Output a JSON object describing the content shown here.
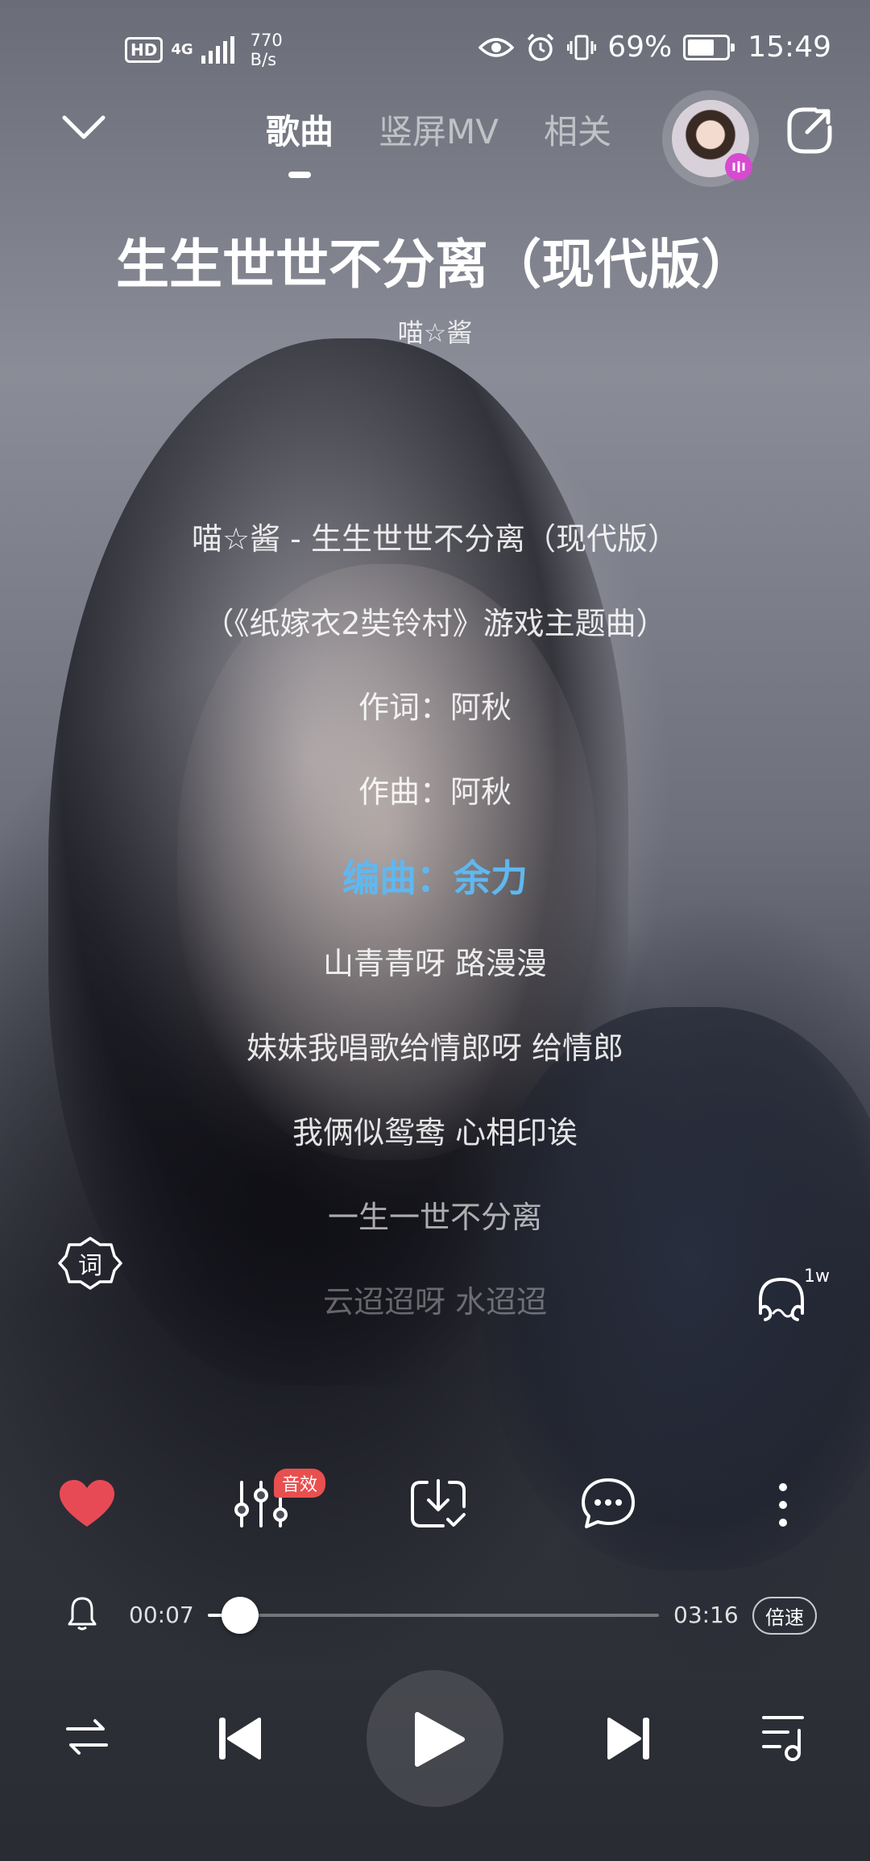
{
  "status_bar": {
    "hd": "HD",
    "network": "4G",
    "speed_value": "770",
    "speed_unit": "B/s",
    "battery": "69%",
    "battery_level": 0.69,
    "time": "15:49"
  },
  "header": {
    "tabs": [
      {
        "label": "歌曲",
        "active": true
      },
      {
        "label": "竖屏MV",
        "active": false
      },
      {
        "label": "相关",
        "active": false
      }
    ]
  },
  "song": {
    "title": "生生世世不分离（现代版）",
    "artist": "喵☆酱"
  },
  "lyrics": [
    {
      "text": "喵☆酱 - 生生世世不分离（现代版）",
      "state": "past"
    },
    {
      "text": "（《纸嫁衣2奘铃村》游戏主题曲）",
      "state": "past"
    },
    {
      "text": "作词：阿秋",
      "state": "past"
    },
    {
      "text": "作曲：阿秋",
      "state": "past"
    },
    {
      "text": "编曲：余力",
      "state": "current"
    },
    {
      "text": "山青青呀 路漫漫",
      "state": "next"
    },
    {
      "text": "妹妹我唱歌给情郎呀 给情郎",
      "state": "next"
    },
    {
      "text": "我俩似鸳鸯 心相印诶",
      "state": "next"
    },
    {
      "text": "一生一世不分离",
      "state": "fade1"
    },
    {
      "text": "云迢迢呀 水迢迢",
      "state": "fade2"
    }
  ],
  "side": {
    "lyric_button": "词",
    "listen_count": "1w"
  },
  "actions": {
    "sound_effect_tag": "音效"
  },
  "progress": {
    "current": "00:07",
    "total": "03:16",
    "fraction": 0.036,
    "speed_label": "倍速"
  },
  "colors": {
    "accent_lyric": "#5fb8f0",
    "like": "#e84a55",
    "tag": "#e8504f"
  }
}
